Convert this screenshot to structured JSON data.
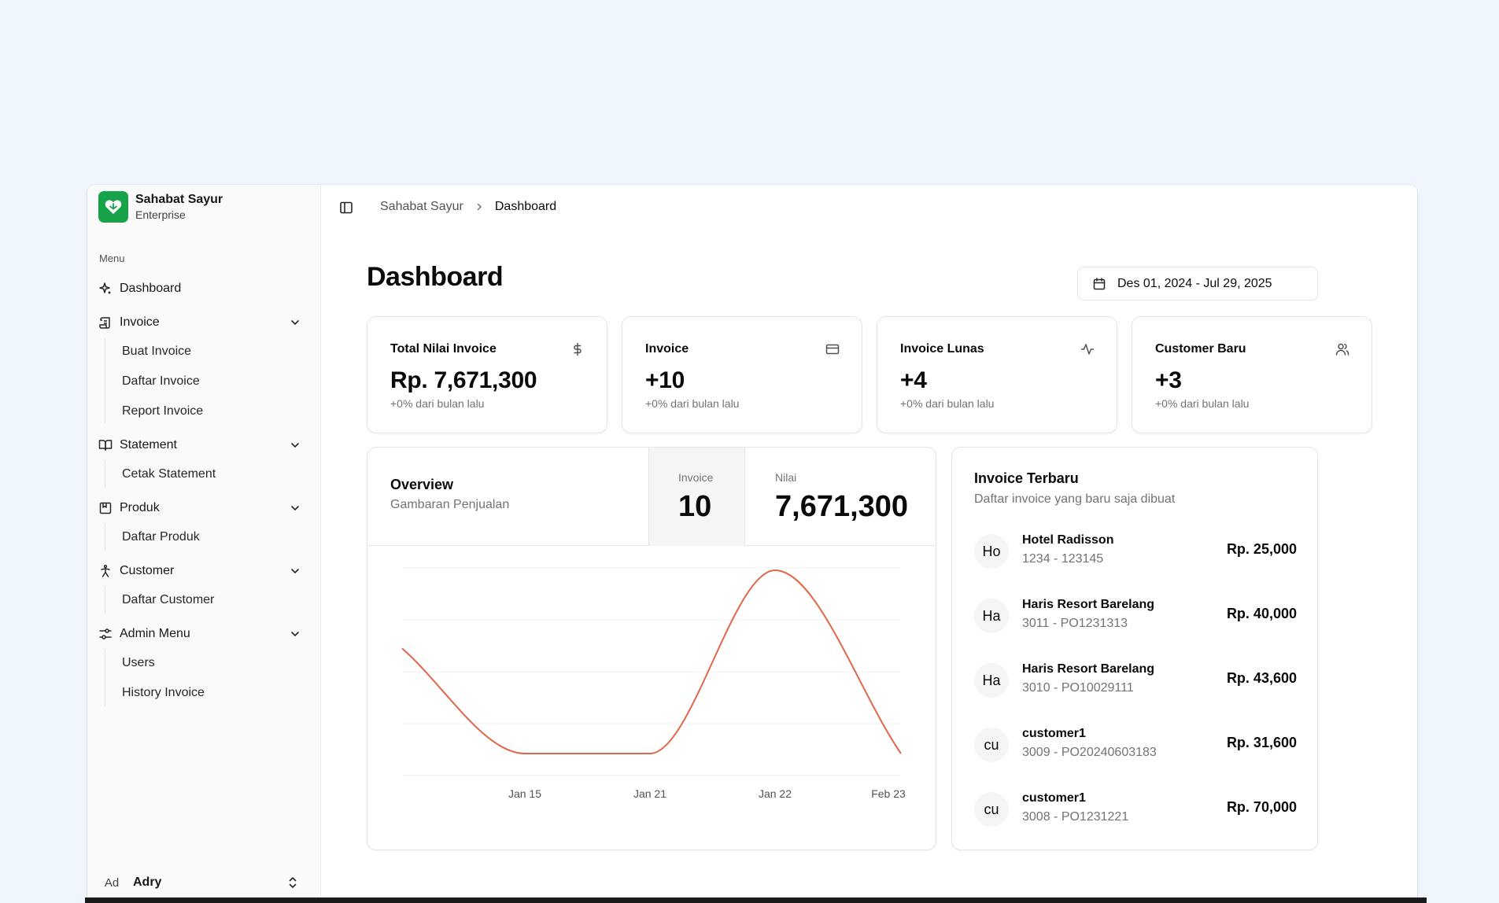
{
  "brand": {
    "name": "Sahabat Sayur",
    "subtitle": "Enterprise",
    "icon": "heart-leaf-icon",
    "color": "#16a34a"
  },
  "sidebar": {
    "menu_label": "Menu",
    "items": [
      {
        "label": "Dashboard",
        "icon": "sparkle-icon"
      },
      {
        "label": "Invoice",
        "icon": "scroll-icon",
        "children": [
          "Buat Invoice",
          "Daftar Invoice",
          "Report Invoice"
        ]
      },
      {
        "label": "Statement",
        "icon": "book-open-icon",
        "children": [
          "Cetak Statement"
        ]
      },
      {
        "label": "Produk",
        "icon": "bookmark-box-icon",
        "children": [
          "Daftar Produk"
        ]
      },
      {
        "label": "Customer",
        "icon": "person-icon",
        "children": [
          "Daftar Customer"
        ]
      },
      {
        "label": "Admin Menu",
        "icon": "sliders-icon",
        "children": [
          "Users",
          "History Invoice"
        ]
      }
    ],
    "user": {
      "initials": "Ad",
      "name": "Adry"
    }
  },
  "breadcrumb": {
    "root": "Sahabat Sayur",
    "current": "Dashboard"
  },
  "page": {
    "title": "Dashboard",
    "date_range": "Des 01, 2024 - Jul 29, 2025"
  },
  "stats": [
    {
      "title": "Total Nilai Invoice",
      "value": "Rp. 7,671,300",
      "sub": "+0% dari bulan lalu",
      "icon": "dollar-icon"
    },
    {
      "title": "Invoice",
      "value": "+10",
      "sub": "+0% dari bulan lalu",
      "icon": "credit-card-icon"
    },
    {
      "title": "Invoice Lunas",
      "value": "+4",
      "sub": "+0% dari bulan lalu",
      "icon": "activity-icon"
    },
    {
      "title": "Customer Baru",
      "value": "+3",
      "sub": "+0% dari bulan lalu",
      "icon": "users-icon"
    }
  ],
  "overview": {
    "title": "Overview",
    "description": "Gambaran Penjualan",
    "metric_invoice_label": "Invoice",
    "metric_invoice_value": "10",
    "metric_nilai_label": "Nilai",
    "metric_nilai_value": "7,671,300"
  },
  "chart_data": {
    "type": "line",
    "x": [
      "",
      "Jan 15",
      "Jan 21",
      "Jan 22",
      "Feb 23"
    ],
    "series": [
      {
        "values": [
          25000,
          0,
          0,
          43600,
          0
        ]
      }
    ],
    "xtick_labels": [
      "Jan 15",
      "Jan 21",
      "Jan 22",
      "Feb 23"
    ],
    "grid": true,
    "line_color": "#e0664a"
  },
  "recent": {
    "title": "Invoice Terbaru",
    "description": "Daftar invoice yang baru saja dibuat",
    "rows": [
      {
        "initials": "Ho",
        "name": "Hotel Radisson",
        "ref": "1234 - 123145",
        "amount": "Rp. 25,000"
      },
      {
        "initials": "Ha",
        "name": "Haris Resort Barelang",
        "ref": "3011 - PO1231313",
        "amount": "Rp. 40,000"
      },
      {
        "initials": "Ha",
        "name": "Haris Resort Barelang",
        "ref": "3010 - PO10029111",
        "amount": "Rp. 43,600"
      },
      {
        "initials": "cu",
        "name": "customer1",
        "ref": "3009 - PO20240603183",
        "amount": "Rp. 31,600"
      },
      {
        "initials": "cu",
        "name": "customer1",
        "ref": "3008 - PO1231221",
        "amount": "Rp. 70,000"
      }
    ]
  }
}
